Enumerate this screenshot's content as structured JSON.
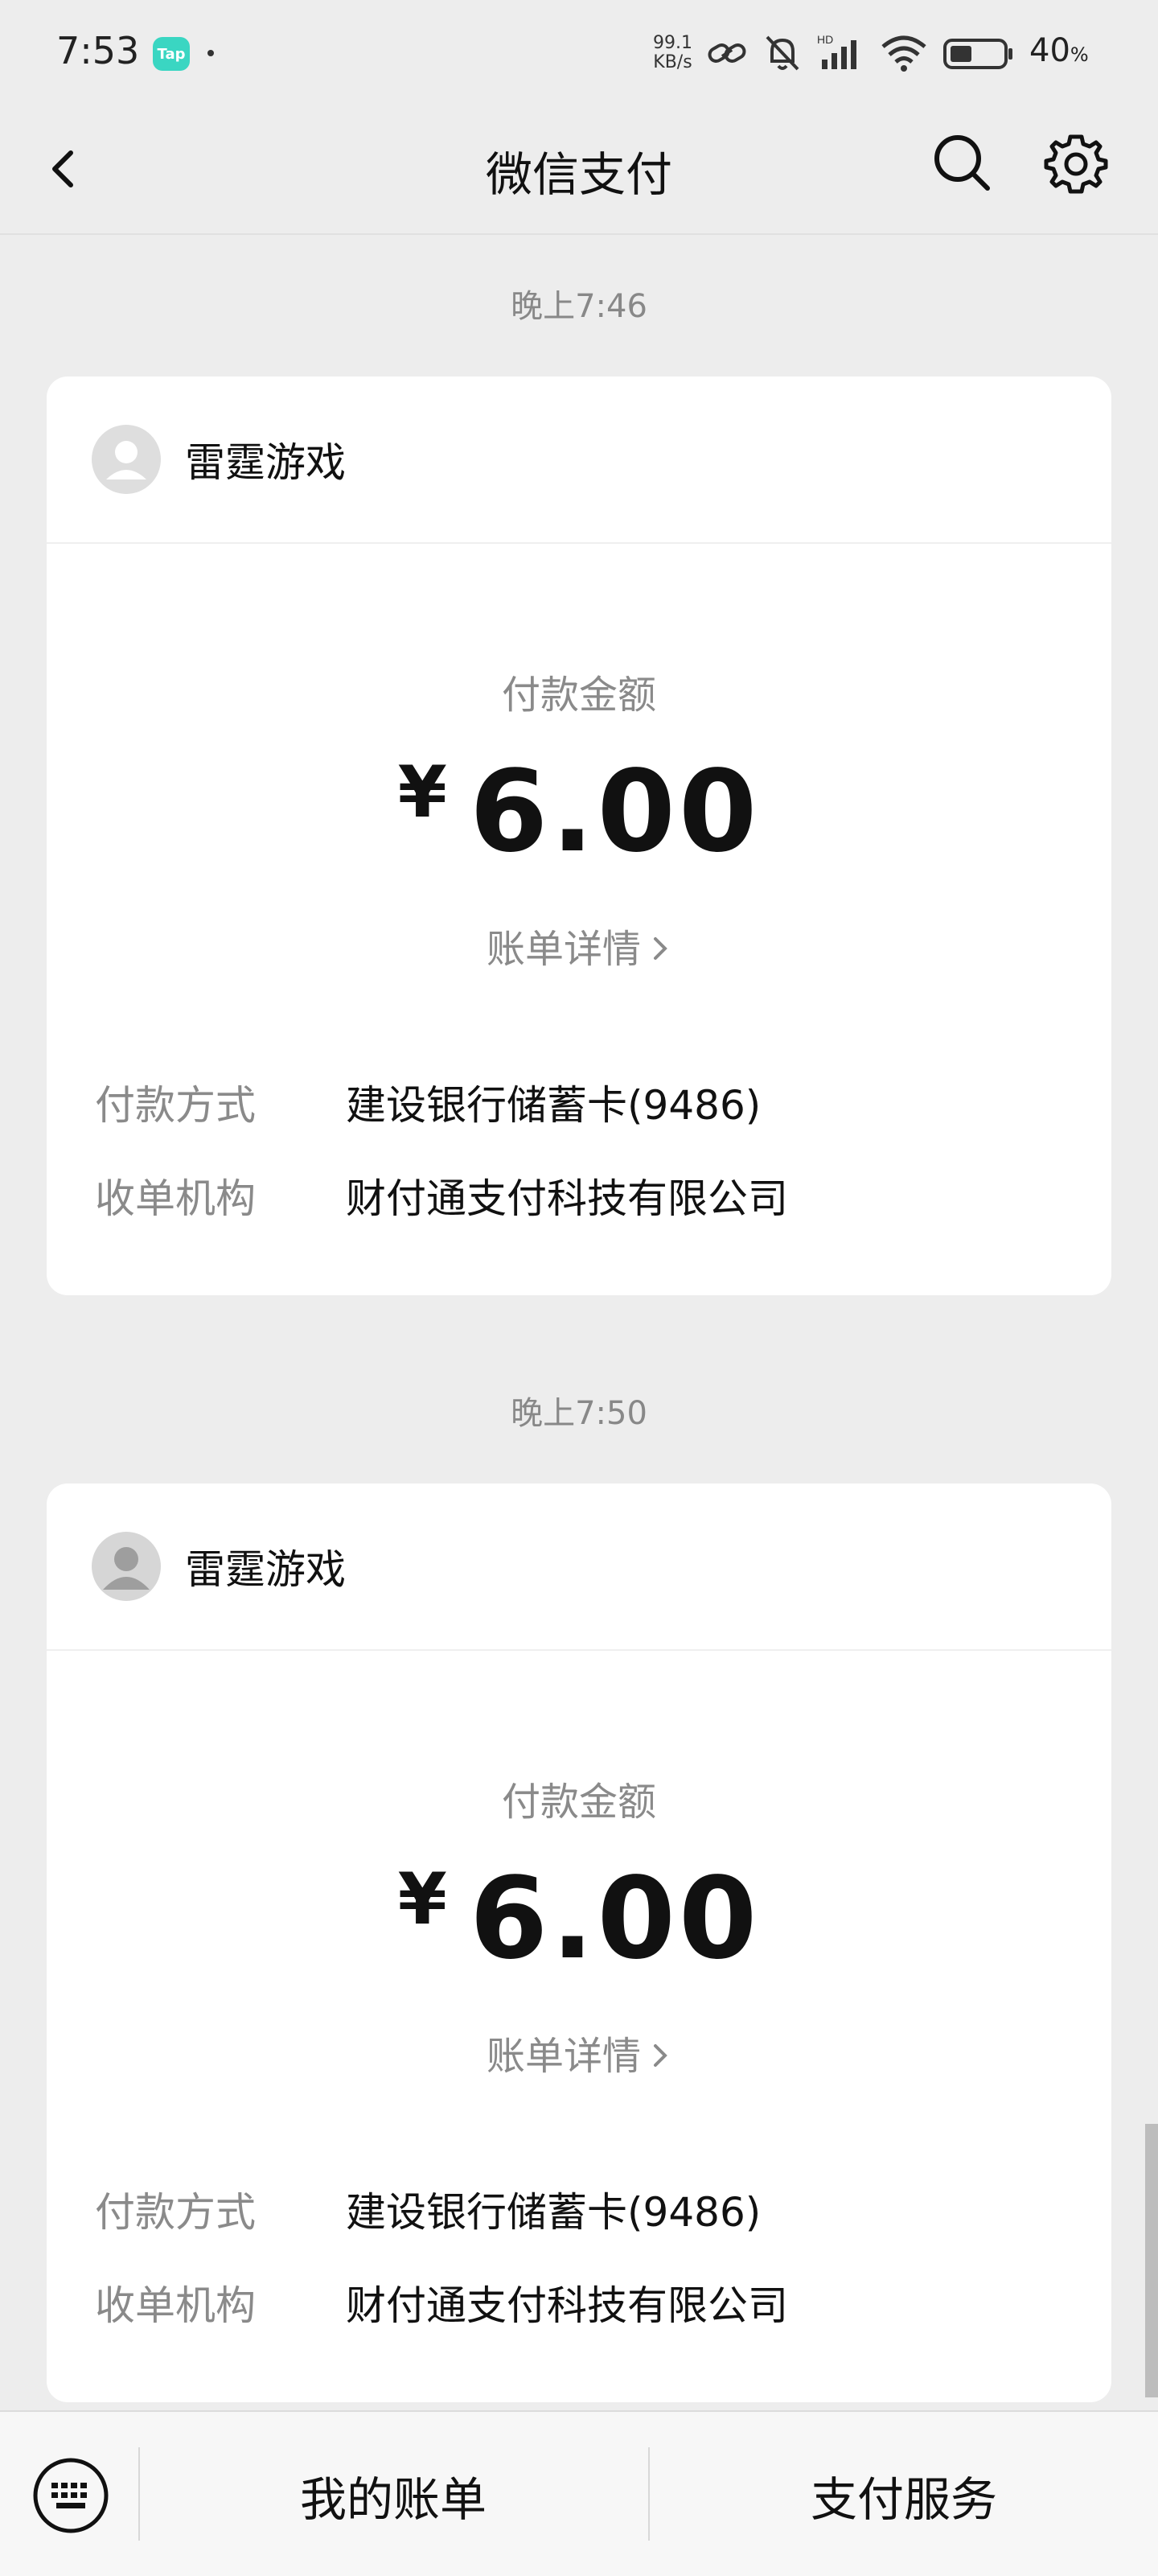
{
  "status_bar": {
    "time": "7:53",
    "app_badge": "Tap",
    "net_speed_value": "99.1",
    "net_speed_unit": "KB/s",
    "battery_percent": "40",
    "battery_unit": "%"
  },
  "nav": {
    "title": "微信支付"
  },
  "messages": [
    {
      "time": "晚上7:46",
      "merchant": "雷霆游戏",
      "amount_label": "付款金额",
      "currency": "¥",
      "amount": "6.00",
      "detail_link": "账单详情",
      "payment_method_label": "付款方式",
      "payment_method": "建设银行储蓄卡(9486)",
      "acquirer_label": "收单机构",
      "acquirer": "财付通支付科技有限公司"
    },
    {
      "time": "晚上7:50",
      "merchant": "雷霆游戏",
      "amount_label": "付款金额",
      "currency": "¥",
      "amount": "6.00",
      "detail_link": "账单详情",
      "payment_method_label": "付款方式",
      "payment_method": "建设银行储蓄卡(9486)",
      "acquirer_label": "收单机构",
      "acquirer": "财付通支付科技有限公司"
    }
  ],
  "bottom_bar": {
    "my_bills": "我的账单",
    "pay_services": "支付服务"
  },
  "icons": {
    "back": "back-arrow-icon",
    "search": "search-icon",
    "settings": "gear-icon",
    "keyboard": "keyboard-icon",
    "avatar": "default-avatar-icon",
    "chevron": "chevron-right-icon"
  }
}
